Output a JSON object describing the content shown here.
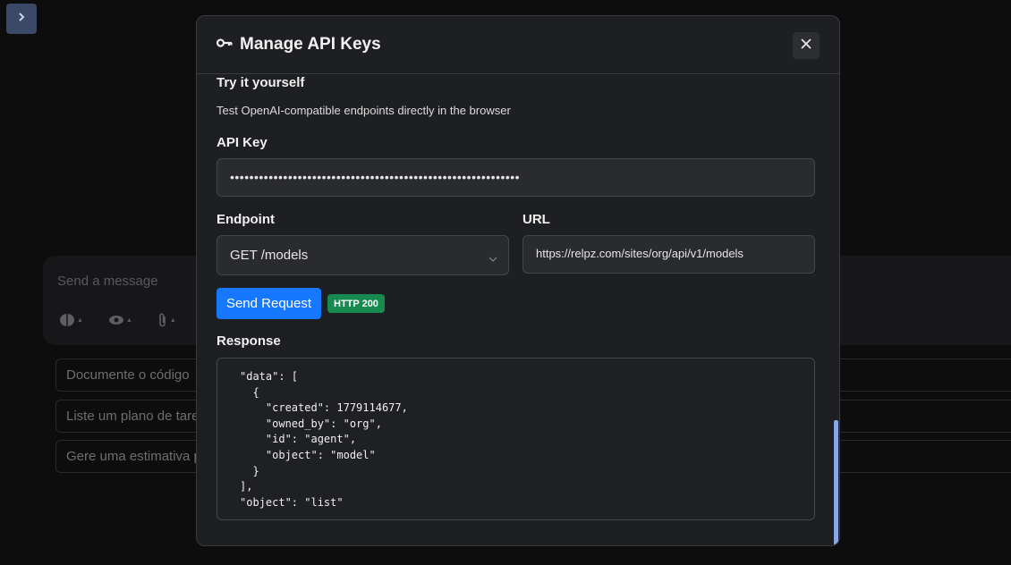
{
  "background": {
    "composer_placeholder": "Send a message",
    "suggestions": [
      "Documente o código",
      "Liste um plano de tare",
      "Gere uma estimativa p"
    ]
  },
  "modal": {
    "title": "Manage API Keys",
    "section_title": "Try it yourself",
    "section_desc": "Test OpenAI-compatible endpoints directly in the browser",
    "api_key_label": "API Key",
    "api_key_value": "••••••••••••••••••••••••••••••••••••••••••••••••••••••••••••",
    "endpoint_label": "Endpoint",
    "endpoint_selected": "GET /models",
    "url_label": "URL",
    "url_value": "https://relpz.com/sites/org/api/v1/models",
    "send_label": "Send Request",
    "status": "HTTP 200",
    "response_label": "Response",
    "response_body": "\"data\": [\n  {\n    \"created\": 1779114677,\n    \"owned_by\": \"org\",\n    \"id\": \"agent\",\n    \"object\": \"model\"\n  }\n],\n\"object\": \"list\""
  },
  "colors": {
    "accent": "#1677ff",
    "status_success": "#178a4f",
    "modal_bg": "#1e1f22"
  },
  "icons": [
    "chevron-right-icon",
    "brain-icon",
    "eye-icon",
    "paperclip-icon",
    "key-icon",
    "close-icon",
    "chevron-down-icon"
  ]
}
